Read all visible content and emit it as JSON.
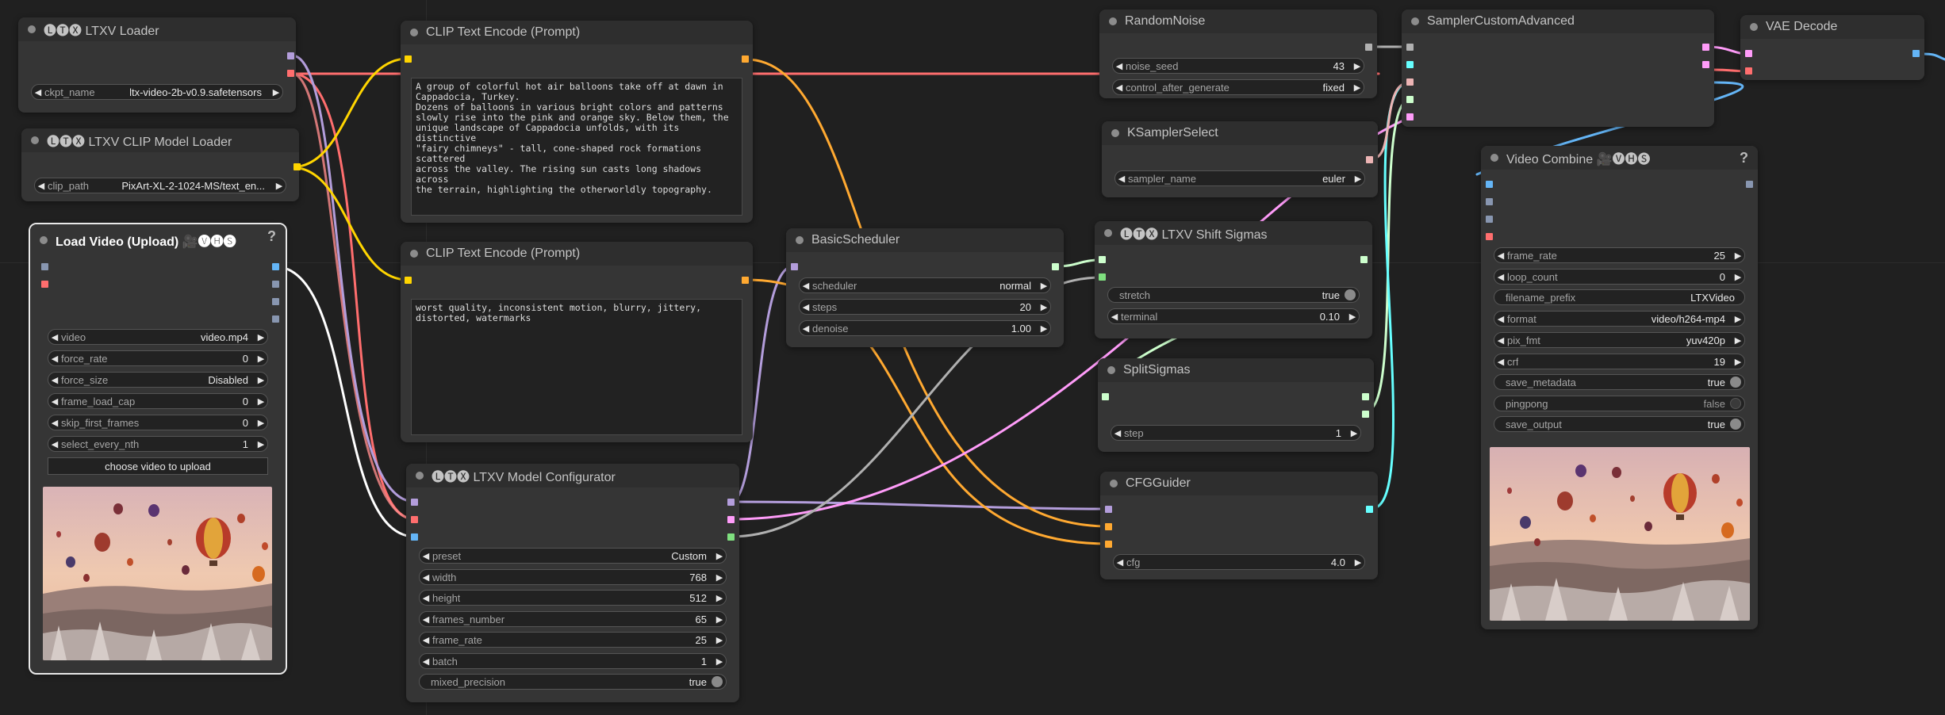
{
  "nodes": {
    "ltxv_loader": {
      "title": "LTXV Loader",
      "badge": "🅛🅣🅧",
      "widgets": {
        "ckpt_name": {
          "label": "ckpt_name",
          "value": "ltx-video-2b-v0.9.safetensors"
        }
      }
    },
    "clip_loader": {
      "title": "LTXV CLIP Model Loader",
      "badge": "🅛🅣🅧",
      "widgets": {
        "clip_path": {
          "label": "clip_path",
          "value": "PixArt-XL-2-1024-MS/text_en..."
        }
      }
    },
    "load_video": {
      "title": "Load Video (Upload)",
      "badge": "🎥🅥🅗🅢",
      "help": "?",
      "widgets": {
        "video": {
          "label": "video",
          "value": "video.mp4"
        },
        "force_rate": {
          "label": "force_rate",
          "value": "0"
        },
        "force_size": {
          "label": "force_size",
          "value": "Disabled"
        },
        "frame_load_cap": {
          "label": "frame_load_cap",
          "value": "0"
        },
        "skip_first_frames": {
          "label": "skip_first_frames",
          "value": "0"
        },
        "select_every_nth": {
          "label": "select_every_nth",
          "value": "1"
        }
      },
      "upload_button": "choose video to upload"
    },
    "clip_pos": {
      "title": "CLIP Text Encode (Prompt)",
      "text": "A group of colorful hot air balloons take off at dawn in\nCappadocia, Turkey.\nDozens of balloons in various bright colors and patterns\nslowly rise into the pink and orange sky. Below them, the\nunique landscape of Cappadocia unfolds, with its distinctive\n\"fairy chimneys\" - tall, cone-shaped rock formations scattered\nacross the valley. The rising sun casts long shadows across\nthe terrain, highlighting the otherworldly topography."
    },
    "clip_neg": {
      "title": "CLIP Text Encode (Prompt)",
      "text": "worst quality, inconsistent motion, blurry, jittery,\ndistorted, watermarks"
    },
    "model_config": {
      "title": "LTXV Model Configurator",
      "badge": "🅛🅣🅧",
      "widgets": {
        "preset": {
          "label": "preset",
          "value": "Custom"
        },
        "width": {
          "label": "width",
          "value": "768"
        },
        "height": {
          "label": "height",
          "value": "512"
        },
        "frames_number": {
          "label": "frames_number",
          "value": "65"
        },
        "frame_rate": {
          "label": "frame_rate",
          "value": "25"
        },
        "batch": {
          "label": "batch",
          "value": "1"
        },
        "mixed_precision": {
          "label": "mixed_precision",
          "value": "true"
        }
      }
    },
    "basic_scheduler": {
      "title": "BasicScheduler",
      "widgets": {
        "scheduler": {
          "label": "scheduler",
          "value": "normal"
        },
        "steps": {
          "label": "steps",
          "value": "20"
        },
        "denoise": {
          "label": "denoise",
          "value": "1.00"
        }
      }
    },
    "random_noise": {
      "title": "RandomNoise",
      "widgets": {
        "noise_seed": {
          "label": "noise_seed",
          "value": "43"
        },
        "control_after_generate": {
          "label": "control_after_generate",
          "value": "fixed"
        }
      }
    },
    "ksampler_select": {
      "title": "KSamplerSelect",
      "widgets": {
        "sampler_name": {
          "label": "sampler_name",
          "value": "euler"
        }
      }
    },
    "shift_sigmas": {
      "title": "LTXV Shift Sigmas",
      "badge": "🅛🅣🅧",
      "widgets": {
        "stretch": {
          "label": "stretch",
          "value": "true"
        },
        "terminal": {
          "label": "terminal",
          "value": "0.10"
        }
      }
    },
    "split_sigmas": {
      "title": "SplitSigmas",
      "widgets": {
        "step": {
          "label": "step",
          "value": "1"
        }
      }
    },
    "cfg_guider": {
      "title": "CFGGuider",
      "widgets": {
        "cfg": {
          "label": "cfg",
          "value": "4.0"
        }
      }
    },
    "sampler_custom": {
      "title": "SamplerCustomAdvanced"
    },
    "vae_decode": {
      "title": "VAE Decode"
    },
    "video_combine": {
      "title": "Video Combine",
      "badge": "🎥🅥🅗🅢",
      "help": "?",
      "widgets": {
        "frame_rate": {
          "label": "frame_rate",
          "value": "25"
        },
        "loop_count": {
          "label": "loop_count",
          "value": "0"
        },
        "filename_prefix": {
          "label": "filename_prefix",
          "value": "LTXVideo"
        },
        "format": {
          "label": "format",
          "value": "video/h264-mp4"
        },
        "pix_fmt": {
          "label": "pix_fmt",
          "value": "yuv420p"
        },
        "crf": {
          "label": "crf",
          "value": "19"
        },
        "save_metadata": {
          "label": "save_metadata",
          "value": "true"
        },
        "pingpong": {
          "label": "pingpong",
          "value": "false"
        },
        "save_output": {
          "label": "save_output",
          "value": "true"
        }
      }
    }
  },
  "colors": {
    "background": "#202020",
    "node": "#353535",
    "model_link": "#b39ddb",
    "clip_link": "#ffd500",
    "vae_link": "#ff6e6e",
    "conditioning_link": "#ffa931",
    "image_link": "#64b5f6",
    "latent_link": "#ff9cf9",
    "noise_link": "#b0b0b0",
    "sigmas_link": "#cdffcd",
    "guider_link": "#66ffff",
    "sampler_link": "#ecb4b4"
  },
  "icons": {
    "toggle": "toggle-dot",
    "left_arrow": "triangle-left",
    "right_arrow": "triangle-right",
    "help": "question-mark"
  }
}
